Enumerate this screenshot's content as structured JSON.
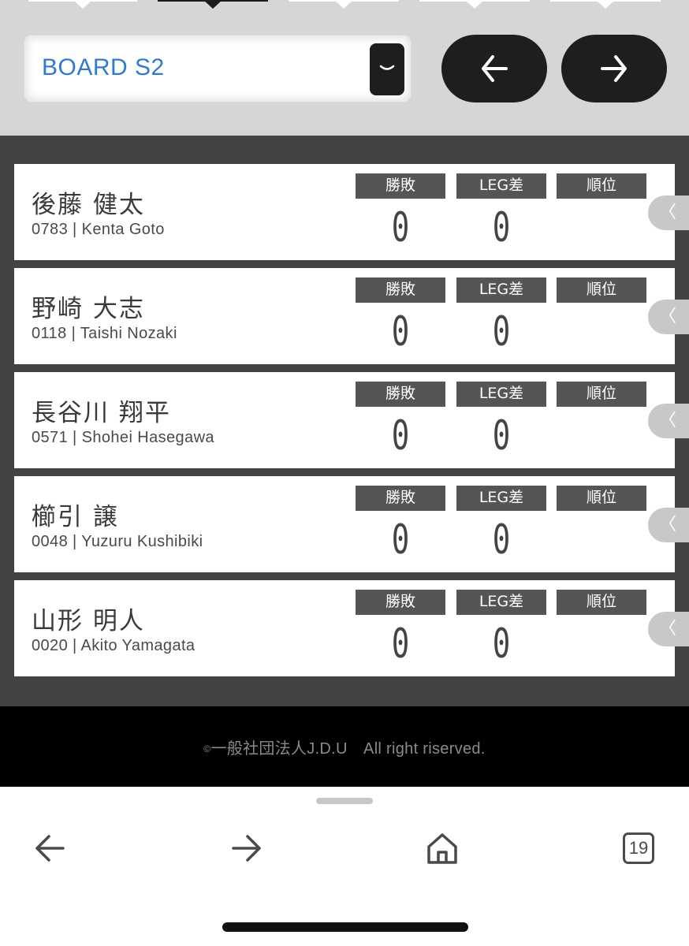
{
  "board": {
    "selected": "BOARD S2"
  },
  "players": [
    {
      "name": "後藤 健太",
      "id": "0783",
      "romaji": "Kenta Goto",
      "win_loss": "0",
      "leg_diff": "0",
      "rank": ""
    },
    {
      "name": "野崎 大志",
      "id": "0118",
      "romaji": "Taishi Nozaki",
      "win_loss": "0",
      "leg_diff": "0",
      "rank": ""
    },
    {
      "name": "長谷川 翔平",
      "id": "0571",
      "romaji": "Shohei Hasegawa",
      "win_loss": "0",
      "leg_diff": "0",
      "rank": ""
    },
    {
      "name": "櫛引 譲",
      "id": "0048",
      "romaji": "Yuzuru Kushibiki",
      "win_loss": "0",
      "leg_diff": "0",
      "rank": ""
    },
    {
      "name": "山形 明人",
      "id": "0020",
      "romaji": "Akito Yamagata",
      "win_loss": "0",
      "leg_diff": "0",
      "rank": ""
    }
  ],
  "stat_headers": {
    "win_loss": "勝敗",
    "leg_diff": "LEG差",
    "rank": "順位"
  },
  "footer": {
    "copyright_mark": "©",
    "text": "一般社団法人J.D.U　All right riserved."
  },
  "browser": {
    "tab_count": "19"
  },
  "icons": {
    "select": "chevron-down-icon",
    "prev": "arrow-left-icon",
    "next": "arrow-right-icon",
    "expand": "chevron-left-icon",
    "home": "home-icon",
    "tabs": "tabs-icon"
  },
  "colors": {
    "accent_text": "#2f7bd3",
    "dark": "#1e1e1e",
    "board_bg": "#434343",
    "header_bg": "#555555"
  }
}
